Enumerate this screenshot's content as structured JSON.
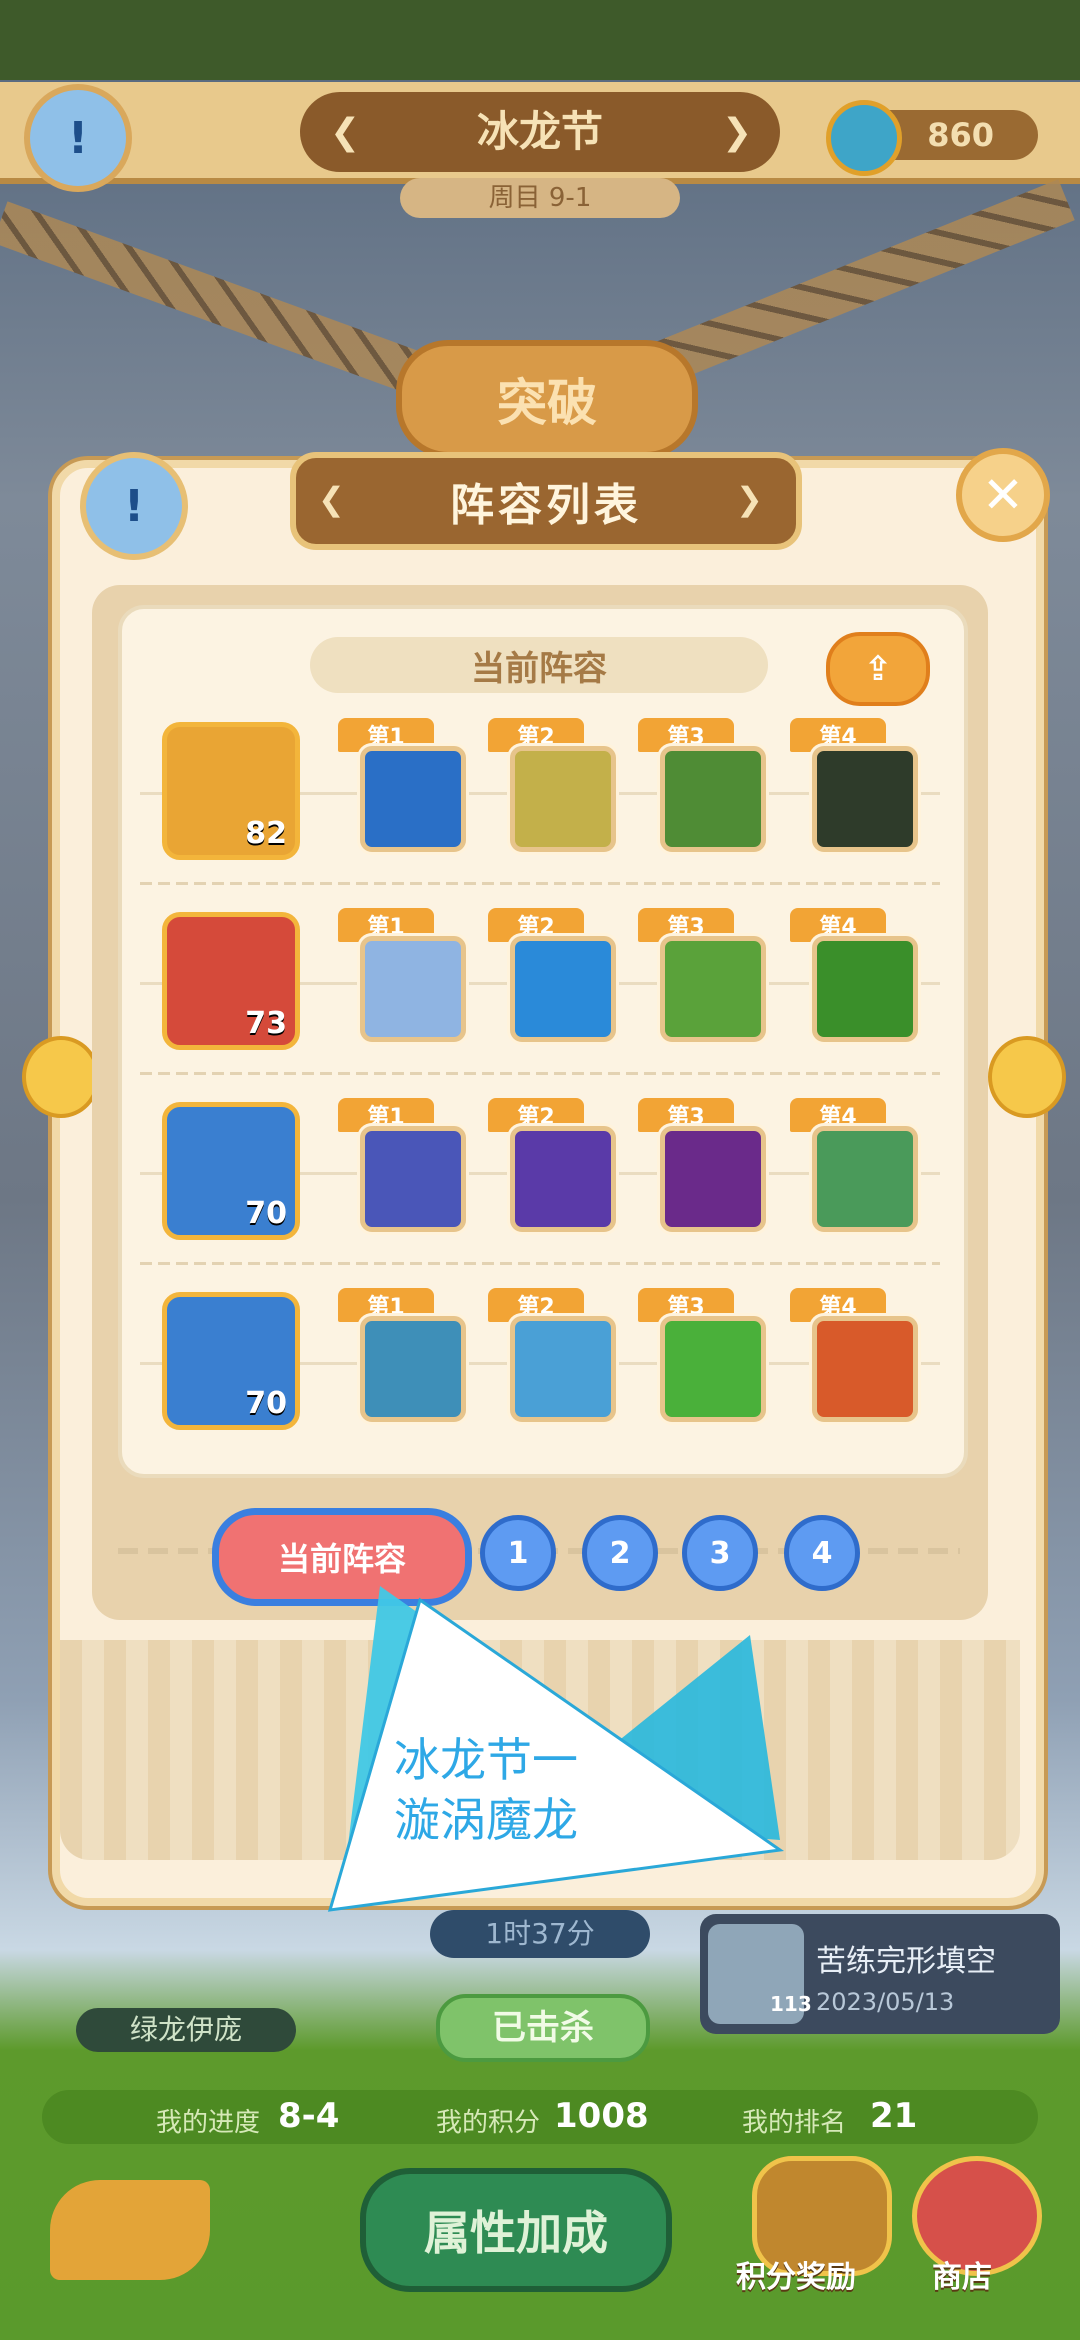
{
  "header": {
    "event_title": "冰龙节",
    "round_label": "周目 9-1",
    "coin_count": "860",
    "breakthrough_label": "突破"
  },
  "modal": {
    "title": "阵容列表",
    "current_lineup_label": "当前阵容",
    "rows": [
      {
        "level": "82",
        "hero_color": "#e9a534",
        "skills": [
          {
            "tag": "第1",
            "icon": "ice-slash-icon",
            "color": "#2a6fc6"
          },
          {
            "tag": "第2",
            "icon": "gold-shield-icon",
            "color": "#c3b04a"
          },
          {
            "tag": "第3",
            "icon": "star-shield-icon",
            "color": "#4f8c35"
          },
          {
            "tag": "第4",
            "icon": "dark-armor-icon",
            "color": "#2e3b2a"
          }
        ]
      },
      {
        "level": "73",
        "hero_color": "#d54a3a",
        "skills": [
          {
            "tag": "第1",
            "icon": "lion-warrior-icon",
            "color": "#8fb4e2"
          },
          {
            "tag": "第2",
            "icon": "spear-icon",
            "color": "#2a8ad9"
          },
          {
            "tag": "第3",
            "icon": "green-beast-icon",
            "color": "#5aa23a"
          },
          {
            "tag": "第4",
            "icon": "green-spear-icon",
            "color": "#3a8f2a"
          }
        ]
      },
      {
        "level": "70",
        "hero_color": "#3a7fd0",
        "skills": [
          {
            "tag": "第1",
            "icon": "ice-dash-icon",
            "color": "#4a56b8"
          },
          {
            "tag": "第2",
            "icon": "purple-rain-icon",
            "color": "#5a3aa8"
          },
          {
            "tag": "第3",
            "icon": "purple-burst-icon",
            "color": "#6a2a8a"
          },
          {
            "tag": "第4",
            "icon": "peach-plant-icon",
            "color": "#4a9a5a"
          }
        ]
      },
      {
        "level": "70",
        "hero_color": "#3a7fd0",
        "skills": [
          {
            "tag": "第1",
            "icon": "red-mask-icon",
            "color": "#3e8fb8"
          },
          {
            "tag": "第2",
            "icon": "ice-staff-icon",
            "color": "#4aa0d6"
          },
          {
            "tag": "第3",
            "icon": "green-tree-icon",
            "color": "#4ab03a"
          },
          {
            "tag": "第4",
            "icon": "fist-icon",
            "color": "#d85a2a"
          }
        ]
      }
    ],
    "tabs": {
      "current": "当前阵容",
      "numbers": [
        "1",
        "2",
        "3",
        "4"
      ]
    }
  },
  "overlay": {
    "line1": "冰龙节一",
    "line2": "漩涡魔龙",
    "timer": "1时37分",
    "killed_label": "已击杀",
    "left_name": "绿龙伊庞",
    "recent_title": "苦练完形填空",
    "recent_date": "2023/05/13",
    "recent_level": "113"
  },
  "stats": {
    "progress_label": "我的进度",
    "progress_value": "8-4",
    "score_label": "我的积分",
    "score_value": "1008",
    "rank_label": "我的排名",
    "rank_value": "21"
  },
  "footer": {
    "attr_button": "属性加成",
    "rewards_label": "积分奖励",
    "shop_label": "商店"
  }
}
